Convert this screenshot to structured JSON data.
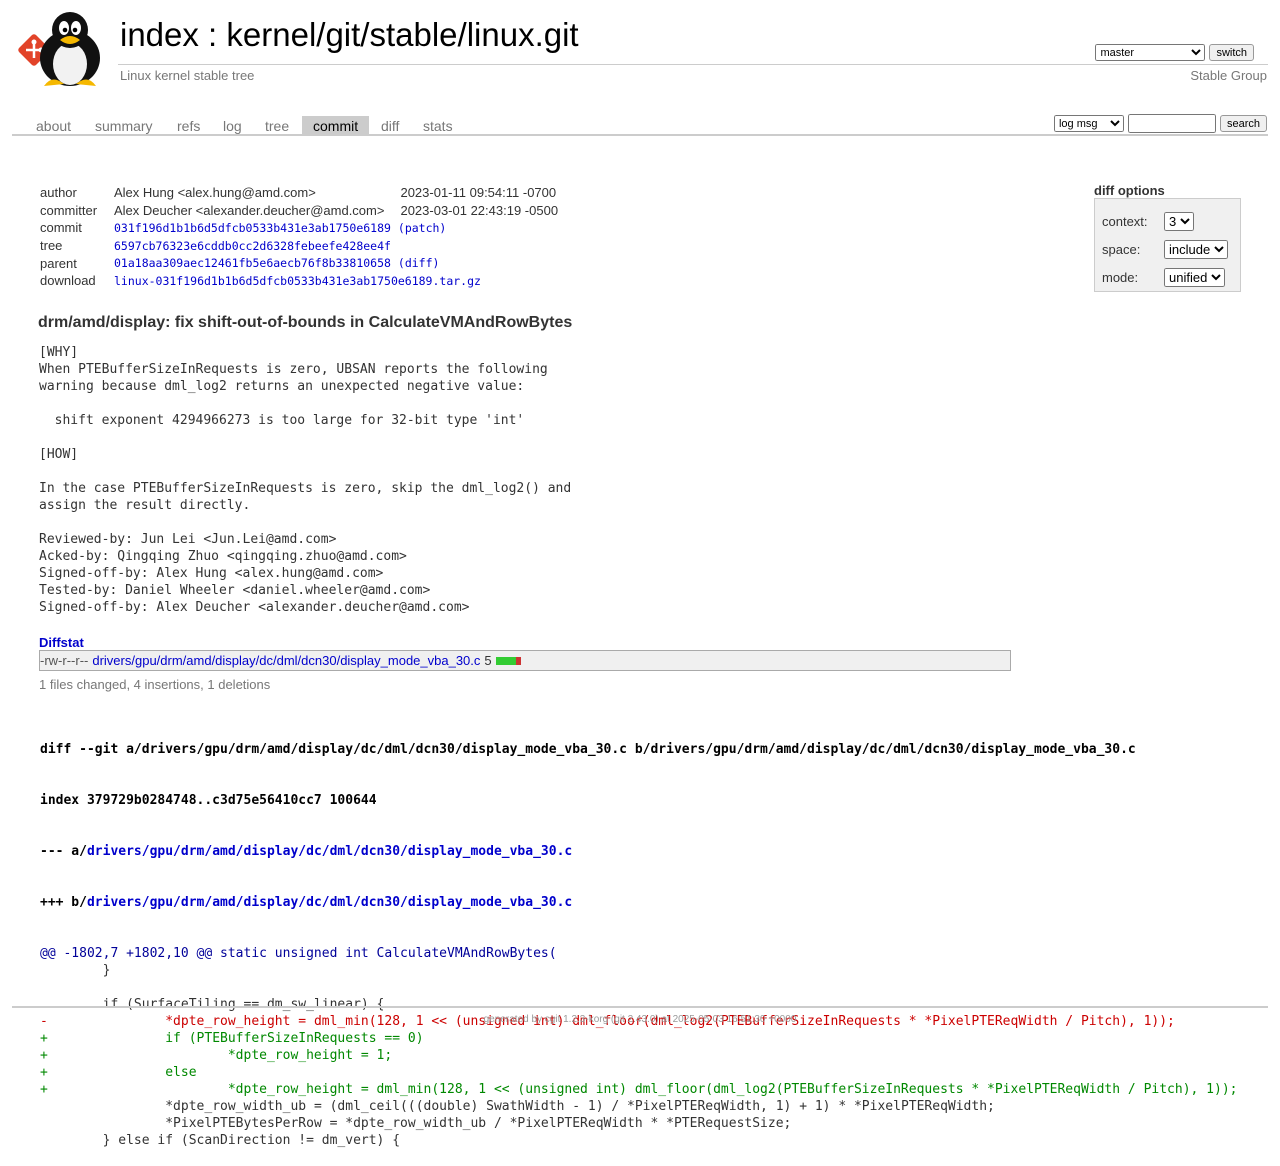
{
  "header": {
    "title_index": "index",
    "title_sep": " : ",
    "title_repo": "kernel/git/stable/linux.git",
    "subtitle": "Linux kernel stable tree",
    "owner": "Stable Group",
    "branch_selected": "master",
    "switch_label": "switch"
  },
  "tabs": [
    "about",
    "summary",
    "refs",
    "log",
    "tree",
    "commit",
    "diff",
    "stats"
  ],
  "active_tab": "commit",
  "search": {
    "scope": "log msg",
    "button": "search",
    "value": ""
  },
  "commit_info": {
    "author_label": "author",
    "author": "Alex Hung <alex.hung@amd.com>",
    "author_date": "2023-01-11 09:54:11 -0700",
    "committer_label": "committer",
    "committer": "Alex Deucher <alexander.deucher@amd.com>",
    "committer_date": "2023-03-01 22:43:19 -0500",
    "commit_label": "commit",
    "commit": "031f196d1b1b6d5dfcb0533b431e3ab1750e6189",
    "commit_link": "(patch)",
    "tree_label": "tree",
    "tree": "6597cb76323e6cddb0cc2d6328febeefe428ee4f",
    "parent_label": "parent",
    "parent": "01a18aa309aec12461fb5e6aecb76f8b33810658",
    "parent_link": "(diff)",
    "download_label": "download",
    "download": "linux-031f196d1b1b6d5dfcb0533b431e3ab1750e6189.tar.gz"
  },
  "diff_options": {
    "title": "diff options",
    "context_label": "context:",
    "context_value": "3",
    "space_label": "space:",
    "space_value": "include",
    "mode_label": "mode:",
    "mode_value": "unified"
  },
  "commit_subject": "drm/amd/display: fix shift-out-of-bounds in CalculateVMAndRowBytes",
  "commit_message": "[WHY]\nWhen PTEBufferSizeInRequests is zero, UBSAN reports the following\nwarning because dml_log2 returns an unexpected negative value:\n\n  shift exponent 4294966273 is too large for 32-bit type 'int'\n\n[HOW]\n\nIn the case PTEBufferSizeInRequests is zero, skip the dml_log2() and\nassign the result directly.\n\nReviewed-by: Jun Lei <Jun.Lei@amd.com>\nAcked-by: Qingqing Zhuo <qingqing.zhuo@amd.com>\nSigned-off-by: Alex Hung <alex.hung@amd.com>\nTested-by: Daniel Wheeler <daniel.wheeler@amd.com>\nSigned-off-by: Alex Deucher <alexander.deucher@amd.com>",
  "diffstat": {
    "title": "Diffstat",
    "mode": "-rw-r--r--",
    "file": "drivers/gpu/drm/amd/display/dc/dml/dcn30/display_mode_vba_30.c",
    "count": "5",
    "insertions": 4,
    "deletions": 1,
    "summary": "1 files changed, 4 insertions, 1 deletions"
  },
  "diff": {
    "git_line": "diff --git a/drivers/gpu/drm/amd/display/dc/dml/dcn30/display_mode_vba_30.c b/drivers/gpu/drm/amd/display/dc/dml/dcn30/display_mode_vba_30.c",
    "index_line": "index 379729b0284748..c3d75e56410cc7 100644",
    "minus_prefix": "--- a/",
    "plus_prefix": "+++ b/",
    "file_path": "drivers/gpu/drm/amd/display/dc/dml/dcn30/display_mode_vba_30.c",
    "lines": [
      {
        "type": "hunk",
        "text": "@@ -1802,7 +1802,10 @@ static unsigned int CalculateVMAndRowBytes("
      },
      {
        "type": "ctx",
        "text": " \t}"
      },
      {
        "type": "ctx",
        "text": " "
      },
      {
        "type": "ctx",
        "text": " \tif (SurfaceTiling == dm_sw_linear) {"
      },
      {
        "type": "rem",
        "text": "-\t\t*dpte_row_height = dml_min(128, 1 << (unsigned int) dml_floor(dml_log2(PTEBufferSizeInRequests * *PixelPTEReqWidth / Pitch), 1));"
      },
      {
        "type": "add",
        "text": "+\t\tif (PTEBufferSizeInRequests == 0)"
      },
      {
        "type": "add",
        "text": "+\t\t\t*dpte_row_height = 1;"
      },
      {
        "type": "add",
        "text": "+\t\telse"
      },
      {
        "type": "add",
        "text": "+\t\t\t*dpte_row_height = dml_min(128, 1 << (unsigned int) dml_floor(dml_log2(PTEBufferSizeInRequests * *PixelPTEReqWidth / Pitch), 1));"
      },
      {
        "type": "ctx",
        "text": " \t\t*dpte_row_width_ub = (dml_ceil(((double) SwathWidth - 1) / *PixelPTEReqWidth, 1) + 1) * *PixelPTEReqWidth;"
      },
      {
        "type": "ctx",
        "text": " \t\t*PixelPTEBytesPerRow = *dpte_row_width_ub / *PixelPTEReqWidth * *PTERequestSize;"
      },
      {
        "type": "ctx",
        "text": " \t} else if (ScanDirection != dm_vert) {"
      }
    ]
  },
  "footer": "generated by cgit 1.2.3-korg (git 2.43.0) at 2025-05-03 16:51:30 +0000"
}
